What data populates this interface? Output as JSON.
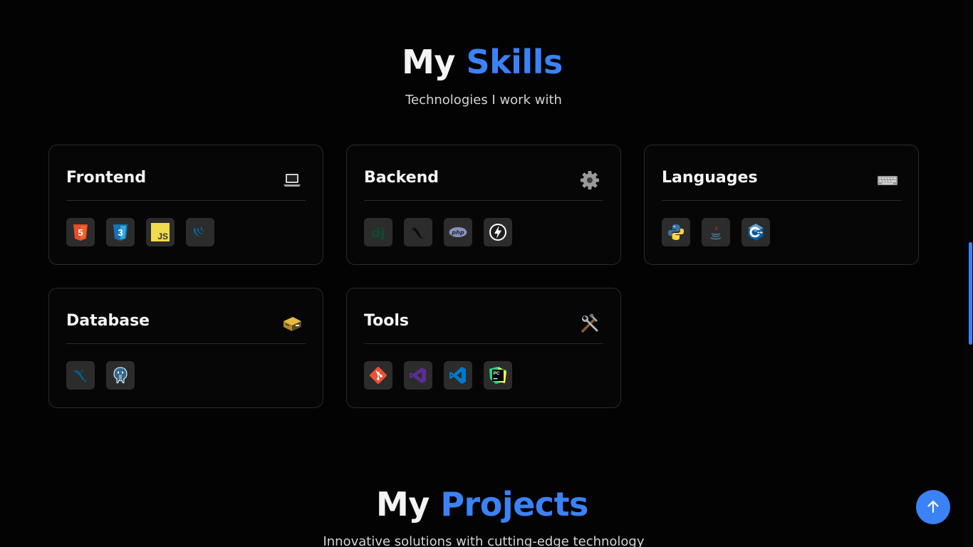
{
  "skills": {
    "title_prefix": "My",
    "title_accent": "Skills",
    "subtitle": "Technologies I work with"
  },
  "cards": {
    "frontend": {
      "title": "Frontend",
      "emoji": "laptop-icon",
      "skills": [
        "html5-icon",
        "css3-icon",
        "javascript-icon",
        "jquery-icon"
      ]
    },
    "backend": {
      "title": "Backend",
      "emoji": "gear-icon",
      "skills": [
        "django-icon",
        "flask-icon",
        "php-icon",
        "fastapi-icon"
      ]
    },
    "languages": {
      "title": "Languages",
      "emoji": "keyboard-icon",
      "skills": [
        "python-icon",
        "java-icon",
        "cplusplus-icon"
      ]
    },
    "database": {
      "title": "Database",
      "emoji": "database-icon",
      "skills": [
        "mysql-icon",
        "postgresql-icon"
      ]
    },
    "tools": {
      "title": "Tools",
      "emoji": "hammer-wrench-icon",
      "skills": [
        "git-icon",
        "visual-studio-icon",
        "vscode-icon",
        "pycharm-icon"
      ]
    }
  },
  "projects": {
    "title_prefix": "My",
    "title_accent": "Projects",
    "subtitle": "Innovative solutions with cutting-edge technology"
  },
  "colors": {
    "accent": "#3b82f6",
    "background": "#030303",
    "card_border": "#2a2a2a"
  },
  "back_to_top": {
    "icon": "arrow-up-icon"
  }
}
